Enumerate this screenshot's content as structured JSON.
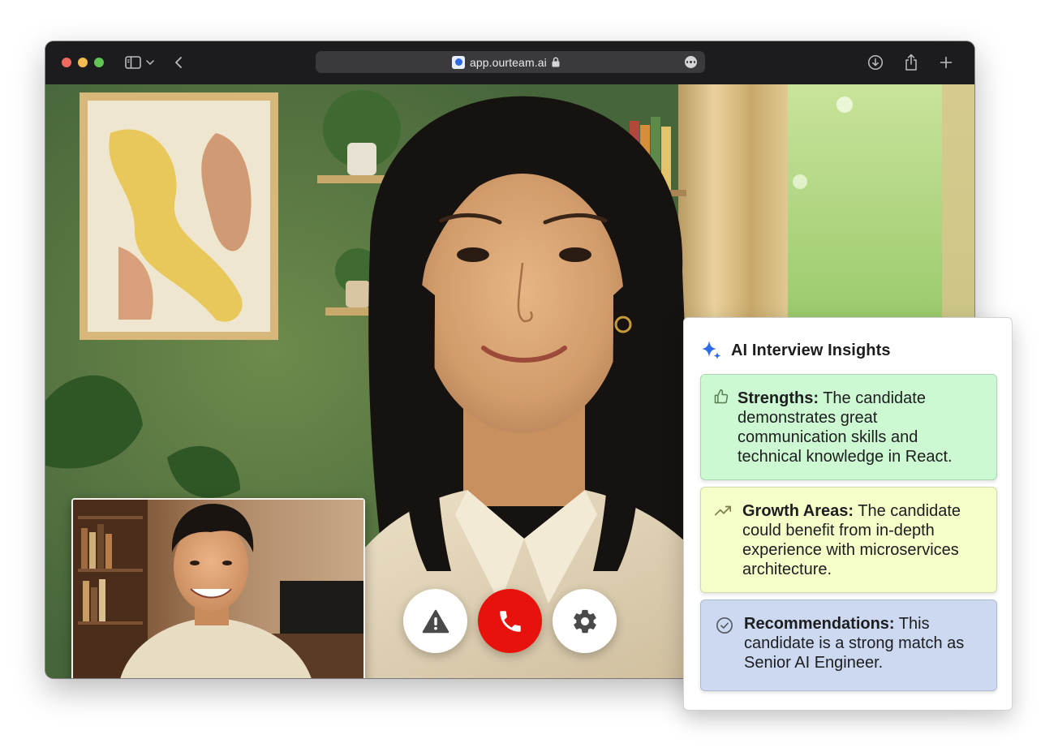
{
  "browser": {
    "url": "app.ourteam.ai"
  },
  "call_controls": {
    "report_icon": "warning-triangle-icon",
    "hangup_icon": "phone-icon",
    "settings_icon": "gear-icon"
  },
  "insights": {
    "icon": "sparkle-icon",
    "title": "AI Interview Insights",
    "cards": [
      {
        "icon": "thumbs-up-icon",
        "heading": "Strengths:",
        "text": " The candidate demonstrates great communication skills and technical knowledge in React."
      },
      {
        "icon": "trending-up-icon",
        "heading": "Growth Areas:",
        "text": " The candidate could benefit from in-depth experience with microservices architecture."
      },
      {
        "icon": "check-circle-icon",
        "heading": "Recommendations:",
        "text": " This candidate is a strong match as Senior AI Engineer."
      }
    ]
  },
  "colors": {
    "hangup": "#e8120c",
    "accent": "#2f6be5",
    "strengths_bg": "#cdf9d2",
    "growth_bg": "#f5fdc9",
    "recommendations_bg": "#ccd9f0"
  }
}
